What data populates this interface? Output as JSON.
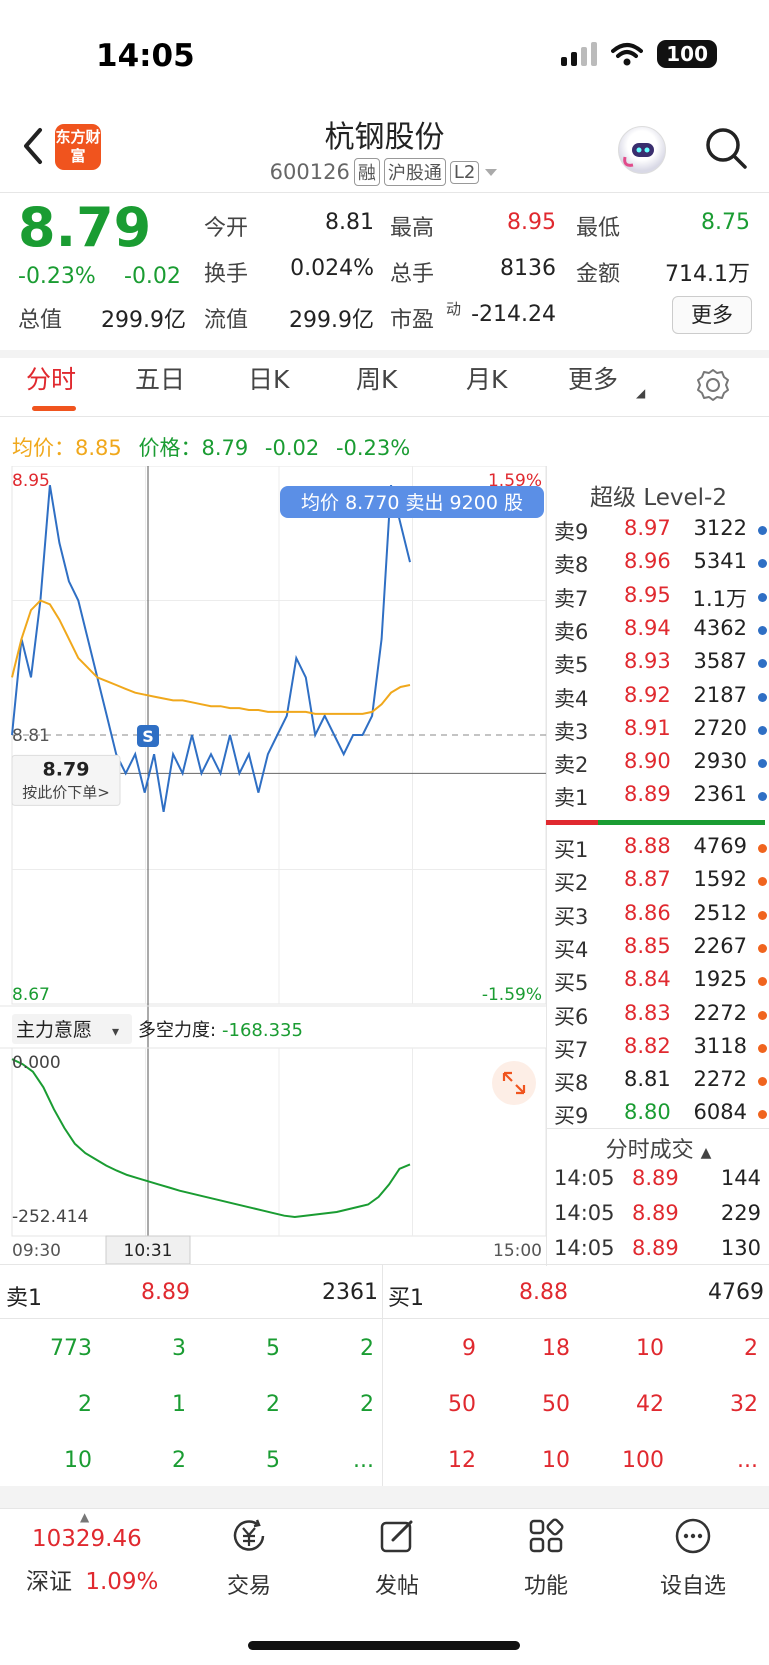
{
  "status": {
    "time": "14:05",
    "battery": "100"
  },
  "header": {
    "logo": "东方财富",
    "title": "杭钢股份",
    "code": "600126",
    "tags": [
      "融",
      "沪股通",
      "L2"
    ]
  },
  "quote": {
    "price": "8.79",
    "change_pct": "-0.23%",
    "change_val": "-0.02",
    "stats": [
      {
        "label": "今开",
        "value": "8.81",
        "color": "#222222"
      },
      {
        "label": "最高",
        "value": "8.95",
        "color": "#e0292f"
      },
      {
        "label": "最低",
        "value": "8.75",
        "color": "#1a9c32"
      },
      {
        "label": "换手",
        "value": "0.024%",
        "color": "#222222"
      },
      {
        "label": "总手",
        "value": "8136",
        "color": "#222222"
      },
      {
        "label": "金额",
        "value": "714.1万",
        "color": "#222222"
      },
      {
        "label": "总值",
        "value": "299.9亿",
        "color": "#222222"
      },
      {
        "label": "流值",
        "value": "299.9亿",
        "color": "#222222"
      },
      {
        "label": "市盈",
        "value": "-214.24",
        "color": "#222222"
      }
    ],
    "pe_superscript": "动",
    "more_label": "更多"
  },
  "tabs": [
    "分时",
    "五日",
    "日K",
    "周K",
    "月K",
    "更多"
  ],
  "avg_info": {
    "avg_label": "均价：",
    "avg_value": "8.85",
    "price_label": "价格：",
    "price_value": "8.79",
    "chg": "-0.02",
    "pct": "-0.23%"
  },
  "chart_data": {
    "type": "line",
    "price_high": "8.95",
    "price_low": "8.67",
    "pct_high": "1.59%",
    "pct_low": "-1.59%",
    "ref_price": "8.81",
    "ylim": [
      8.67,
      8.95
    ],
    "x_labels": [
      "09:30",
      "10:31",
      "15:00"
    ],
    "cursor_price": "8.79",
    "cursor_hint": "按此价下单>",
    "tooltip": "均价 8.770 卖出 9200 股",
    "marker": "S",
    "series": [
      {
        "name": "price",
        "color": "#2f6fc4",
        "values": [
          8.81,
          8.86,
          8.84,
          8.88,
          8.94,
          8.91,
          8.89,
          8.88,
          8.86,
          8.84,
          8.82,
          8.8,
          8.79,
          8.8,
          8.78,
          8.8,
          8.77,
          8.8,
          8.79,
          8.81,
          8.79,
          8.8,
          8.79,
          8.81,
          8.79,
          8.8,
          8.78,
          8.8,
          8.81,
          8.82,
          8.85,
          8.84,
          8.81,
          8.82,
          8.81,
          8.8,
          8.81,
          8.81,
          8.82,
          8.86,
          8.94,
          8.92,
          8.9
        ]
      },
      {
        "name": "avg",
        "color": "#f0a81c",
        "values": [
          8.84,
          8.86,
          8.875,
          8.88,
          8.878,
          8.87,
          8.86,
          8.85,
          8.845,
          8.84,
          8.838,
          8.836,
          8.834,
          8.832,
          8.831,
          8.83,
          8.829,
          8.828,
          8.828,
          8.827,
          8.826,
          8.825,
          8.825,
          8.824,
          8.824,
          8.823,
          8.823,
          8.822,
          8.822,
          8.822,
          8.822,
          8.822,
          8.821,
          8.821,
          8.821,
          8.821,
          8.821,
          8.821,
          8.822,
          8.826,
          8.832,
          8.835,
          8.836
        ]
      }
    ],
    "indicator": {
      "name": "主力意愿",
      "dropdown": "▾",
      "force_label": "多空力度:",
      "force_value": "-168.335",
      "top_label": "0.000",
      "bottom_label": "-252.414",
      "values": [
        0,
        -8,
        -20,
        -45,
        -80,
        -110,
        -135,
        -150,
        -160,
        -170,
        -178,
        -185,
        -190,
        -195,
        -200,
        -205,
        -210,
        -214,
        -218,
        -222,
        -226,
        -230,
        -234,
        -238,
        -242,
        -246,
        -250,
        -252,
        -250,
        -248,
        -246,
        -244,
        -240,
        -236,
        -232,
        -220,
        -200,
        -175,
        -168
      ]
    }
  },
  "level2": {
    "title": "超级 Level-2",
    "asks": [
      {
        "label": "卖9",
        "price": "8.97",
        "vol": "3122"
      },
      {
        "label": "卖8",
        "price": "8.96",
        "vol": "5341"
      },
      {
        "label": "卖7",
        "price": "8.95",
        "vol": "1.1万"
      },
      {
        "label": "卖6",
        "price": "8.94",
        "vol": "4362"
      },
      {
        "label": "卖5",
        "price": "8.93",
        "vol": "3587"
      },
      {
        "label": "卖4",
        "price": "8.92",
        "vol": "2187"
      },
      {
        "label": "卖3",
        "price": "8.91",
        "vol": "2720"
      },
      {
        "label": "卖2",
        "price": "8.90",
        "vol": "2930"
      },
      {
        "label": "卖1",
        "price": "8.89",
        "vol": "2361"
      }
    ],
    "bids": [
      {
        "label": "买1",
        "price": "8.88",
        "vol": "4769",
        "color": "#e0292f"
      },
      {
        "label": "买2",
        "price": "8.87",
        "vol": "1592",
        "color": "#e0292f"
      },
      {
        "label": "买3",
        "price": "8.86",
        "vol": "2512",
        "color": "#e0292f"
      },
      {
        "label": "买4",
        "price": "8.85",
        "vol": "2267",
        "color": "#e0292f"
      },
      {
        "label": "买5",
        "price": "8.84",
        "vol": "1925",
        "color": "#e0292f"
      },
      {
        "label": "买6",
        "price": "8.83",
        "vol": "2272",
        "color": "#e0292f"
      },
      {
        "label": "买7",
        "price": "8.82",
        "vol": "3118",
        "color": "#e0292f"
      },
      {
        "label": "买8",
        "price": "8.81",
        "vol": "2272",
        "color": "#222222"
      },
      {
        "label": "买9",
        "price": "8.80",
        "vol": "6084",
        "color": "#1a9c32"
      }
    ],
    "trades_title": "分时成交",
    "trades": [
      {
        "time": "14:05",
        "price": "8.89",
        "vol": "144"
      },
      {
        "time": "14:05",
        "price": "8.89",
        "vol": "229"
      },
      {
        "time": "14:05",
        "price": "8.89",
        "vol": "130"
      }
    ]
  },
  "book": {
    "sell": {
      "label": "卖1",
      "price": "8.89",
      "vol": "2361",
      "queue": [
        [
          "773",
          "3",
          "5",
          "2"
        ],
        [
          "2",
          "1",
          "2",
          "2"
        ],
        [
          "10",
          "2",
          "5",
          "..."
        ]
      ]
    },
    "buy": {
      "label": "买1",
      "price": "8.88",
      "vol": "4769",
      "queue": [
        [
          "9",
          "18",
          "10",
          "2"
        ],
        [
          "50",
          "50",
          "42",
          "32"
        ],
        [
          "12",
          "10",
          "100",
          "..."
        ]
      ]
    }
  },
  "tabbar": {
    "index_value": "10329.46",
    "index_name": "深证",
    "index_pct": "1.09%",
    "items": [
      {
        "label": "交易",
        "icon": "yuan-icon"
      },
      {
        "label": "发帖",
        "icon": "edit-icon"
      },
      {
        "label": "功能",
        "icon": "grid-icon"
      },
      {
        "label": "设自选",
        "icon": "more-icon"
      }
    ]
  }
}
